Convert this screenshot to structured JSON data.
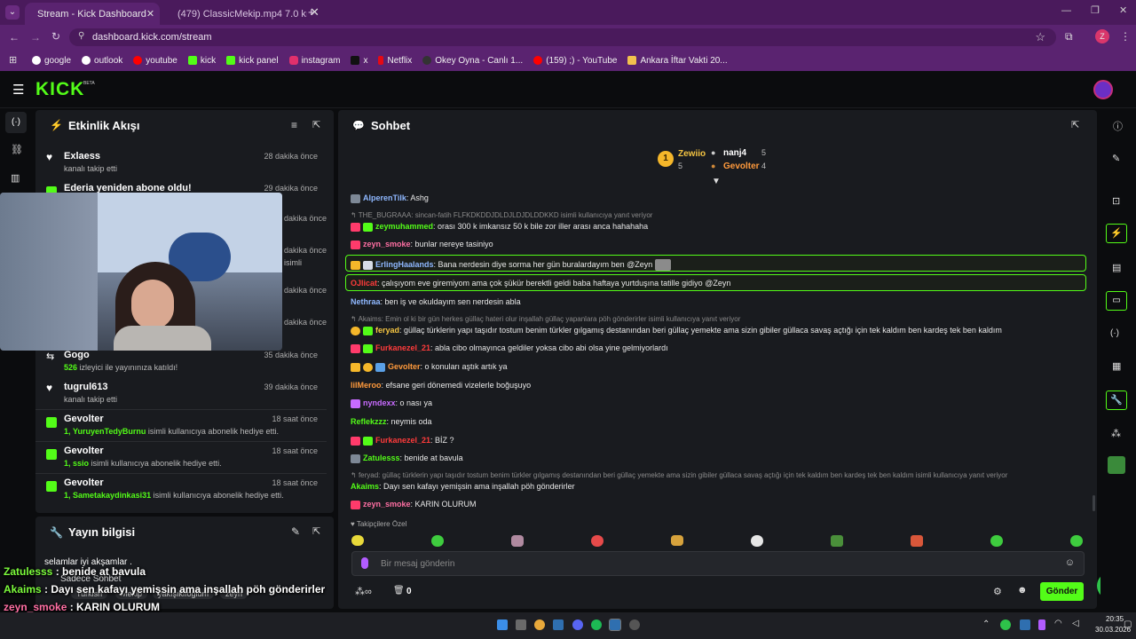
{
  "browser": {
    "tabs": [
      {
        "title": "Stream - Kick Dashboard"
      },
      {
        "title": "(479) ClassicMekip.mp4 7.0 kıs..."
      }
    ],
    "url": "dashboard.kick.com/stream",
    "bookmarks": [
      "google",
      "outlook",
      "youtube",
      "kick",
      "kick panel",
      "instagram",
      "x",
      "Netflix",
      "Okey Oyna - Canlı 1...",
      "(159) ;) - YouTube",
      "Ankara İftar Vakti 20..."
    ],
    "profile_letter": "Z"
  },
  "kick": {
    "logo": "KICK",
    "beta": "BETA"
  },
  "activity": {
    "title": "Etkinlik Akışı",
    "events": [
      {
        "name": "Exlaess",
        "sub": "kanalı takip etti",
        "time": "28 dakika önce"
      },
      {
        "name": "Ederia yeniden abone oldu!",
        "sub": "",
        "time": "29 dakika önce"
      },
      {
        "name": "",
        "sub": "",
        "time": "dakika önce"
      },
      {
        "name": "",
        "sub": "isimli",
        "time": "dakika önce"
      },
      {
        "name": "",
        "sub": "",
        "time": "dakika önce"
      },
      {
        "name": "",
        "sub": "",
        "time": "dakika önce"
      },
      {
        "name": "Gogo",
        "sub_count": "526",
        "sub": "izleyici ile yayınınıza katıldı!",
        "time": "35 dakika önce"
      },
      {
        "name": "tugrul613",
        "sub": "kanalı takip etti",
        "time": "39 dakika önce"
      },
      {
        "name": "Gevolter",
        "sub_count": "1,",
        "sub_user": "YuruyenTedyBurnu",
        "sub": "isimli kullanıcıya abonelik hediye etti.",
        "time": "18 saat önce"
      },
      {
        "name": "Gevolter",
        "sub_count": "1,",
        "sub_user": "ssio",
        "sub": "isimli kullanıcıya abonelik hediye etti.",
        "time": "18 saat önce"
      },
      {
        "name": "Gevolter",
        "sub_count": "1,",
        "sub_user": "Sametakaydinkasi31",
        "sub": "isimli kullanıcıya abonelik hediye etti.",
        "time": "18 saat önce"
      }
    ]
  },
  "stream_info": {
    "title": "Yayın bilgisi",
    "stream_title": "selamlar iyi akşamlar .",
    "mode": "Sadece Sohbet",
    "tags": [
      "Turkish",
      "Mekip",
      "yakışıklıoğlum",
      "zeyn"
    ]
  },
  "overlay_chat": [
    {
      "user": "Zatulesss",
      "msg": " : benide at bavula",
      "color": "#7cfc3c"
    },
    {
      "user": "Akaims",
      "msg": " : Dayı sen kafayı yemişsin ama inşallah pöh gönderirler",
      "color": "#7cfc3c"
    },
    {
      "user": "zeyn_smoke",
      "msg": " : KARIN OLURUM",
      "color": "#ff6fa3"
    }
  ],
  "chat": {
    "title": "Sohbet",
    "top_gifters": [
      {
        "rank": "1",
        "name": "Zewiio",
        "count": "5"
      },
      {
        "name": "nanj4",
        "count": "5"
      },
      {
        "name": "Gevolter",
        "count": "4"
      }
    ],
    "messages": [
      {
        "user": "AlperenTilk",
        "text": ": Ashg",
        "color": "#8fb8ff"
      },
      {
        "reply": "THE_BUGRAAA: sincan-fatih FLFKDKDDJDLDJLDJDLDDKKD isimli kullanıcıya yanıt veriyor"
      },
      {
        "user": "zeymuhammed",
        "text": ": orası 300 k imkansız 50 k bile zor iller arası anca hahahaha",
        "color": "#53fc18"
      },
      {
        "user": "zeyn_smoke",
        "text": ": bunlar nereye tasiniyo",
        "color": "#ff6fa3"
      },
      {
        "user": "ErlingHaalands",
        "text": ": Bana nerdesin diye sorma her gün buralardayım ben @Zeyn",
        "color": "#8fb8ff",
        "highlight": true
      },
      {
        "user": "OJlicat",
        "text": ": çalışıyom eve giremiyom ama çok şükür berektli geldi baba haftaya yurtduşına tatille gidiyo @Zeyn",
        "color": "#ff3b3b",
        "highlight": true
      },
      {
        "user": "Nethraa",
        "text": ": ben iş ve okuldayım sen nerdesin abla",
        "color": "#8fb8ff"
      },
      {
        "reply": "Akaims: Emin ol ki bir gün herkes güllaç hateri olur inşallah güllaç yapanlara pöh gönderirler isimli kullanıcıya yanıt veriyor"
      },
      {
        "user": "feryad",
        "text": ": güllaç türklerin yapı taşıdır tostum benim türkler gılgamış destanından beri güllaç yemekte ama sizin gibiler güllaca savaş açtığı için tek kaldım ben kardeş tek ben kaldım",
        "color": "#f5c542"
      },
      {
        "user": "Furkanezel_21",
        "text": ": abla cibo olmayınca geldiler yoksa cibo abi olsa yine gelmiyorlardı",
        "color": "#ff3b3b"
      },
      {
        "user": "Gevolter",
        "text": ": o konuları aştık artık ya",
        "color": "#ff9a3c"
      },
      {
        "user": "lilMeroo",
        "text": ": efsane geri dönemedi vizelerle boğuşuyo",
        "color": "#ff9a3c"
      },
      {
        "user": "nyndexx",
        "text": ": o nası ya",
        "color": "#c86bff"
      },
      {
        "user": "Reflekzzz",
        "text": ": neymis oda",
        "color": "#53fc18"
      },
      {
        "user": "Furkanezel_21",
        "text": ": BİZ ?",
        "color": "#ff3b3b"
      },
      {
        "user": "Zatulesss",
        "text": ": benide at bavula",
        "color": "#53fc18"
      },
      {
        "reply": "feryad: güllaç türklerin yapı taşıdır tostum benim türkler gılgamış destanından beri güllaç yemekte ama sizin gibiler güllaca savaş açtığı için tek kaldım ben kardeş tek ben kaldım isimli kullanıcıya yanıt veriyor"
      },
      {
        "user": "Akaims",
        "text": ": Dayı sen kafayı yemişsin ama inşallah pöh gönderirler",
        "color": "#53fc18"
      },
      {
        "user": "zeyn_smoke",
        "text": ": KARIN OLURUM",
        "color": "#ff6fa3"
      }
    ],
    "followers_label": "Takipçilere Özel",
    "placeholder": "Bir mesaj gönderin",
    "points_label": "0",
    "send_label": "Gönder"
  },
  "taskbar": {
    "time": "20:35",
    "date": "30.03.2026"
  }
}
